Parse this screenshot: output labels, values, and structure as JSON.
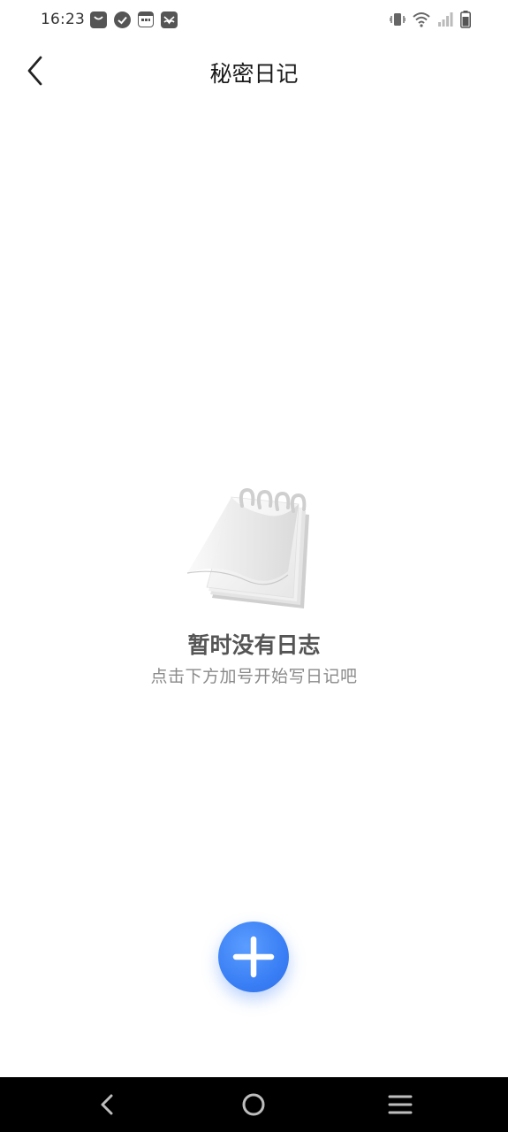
{
  "status_bar": {
    "time": "16:23",
    "left_icons": [
      "shopping-bag-icon",
      "check-circle-icon",
      "calendar-icon",
      "mail-app-icon"
    ],
    "right_icons": [
      "vibrate-icon",
      "wifi-icon",
      "signal-icon",
      "battery-icon"
    ]
  },
  "header": {
    "title": "秘密日记",
    "back_icon": "chevron-left-icon"
  },
  "empty_state": {
    "illustration": "notepad-icon",
    "title": "暂时没有日志",
    "subtitle": "点击下方加号开始写日记吧"
  },
  "fab": {
    "icon": "plus-icon",
    "color": "#3a7ff5"
  },
  "nav_bar": {
    "buttons": [
      "nav-back-icon",
      "nav-home-icon",
      "nav-menu-icon"
    ],
    "background": "#000000"
  }
}
